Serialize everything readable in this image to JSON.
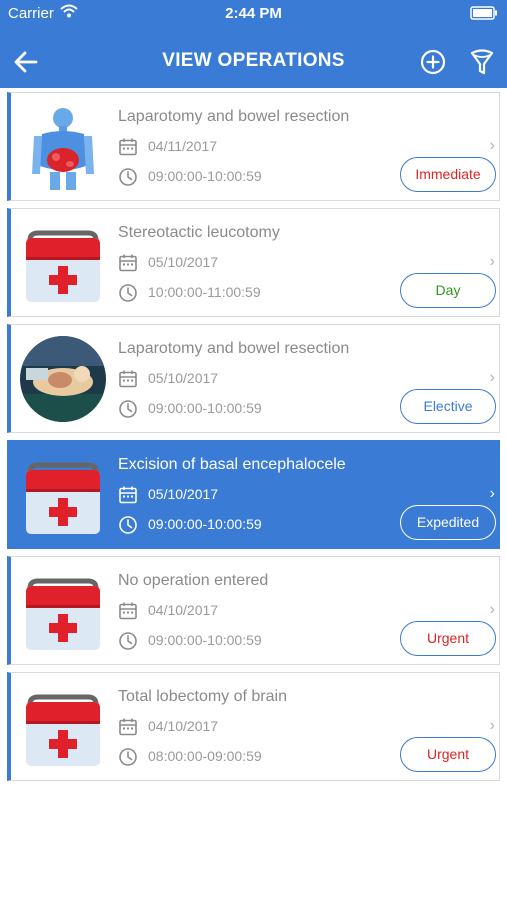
{
  "status_bar": {
    "carrier": "Carrier",
    "time": "2:44 PM"
  },
  "header": {
    "title": "VIEW OPERATIONS"
  },
  "operations": [
    {
      "title": "Laparotomy and bowel resection",
      "date": "04/11/2017",
      "time": "09:00:00-10:00:59",
      "badge": "Immediate",
      "badge_color": "#e02424",
      "image": "body-xray-image"
    },
    {
      "title": "Stereotactic leucotomy",
      "date": "05/10/2017",
      "time": "10:00:00-11:00:59",
      "badge": "Day",
      "badge_color": "#2e9a1f",
      "image": "medical-kit-image"
    },
    {
      "title": "Laparotomy and bowel resection",
      "date": "05/10/2017",
      "time": "09:00:00-10:00:59",
      "badge": "Elective",
      "badge_color": "#3a7bd5",
      "image": "surgery-photo"
    },
    {
      "title": "Excision of basal encephalocele",
      "date": "05/10/2017",
      "time": "09:00:00-10:00:59",
      "badge": "Expedited",
      "badge_color": "#ffffff",
      "image": "medical-kit-image"
    },
    {
      "title": "No operation entered",
      "date": "04/10/2017",
      "time": "09:00:00-10:00:59",
      "badge": "Urgent",
      "badge_color": "#e02424",
      "image": "medical-kit-image"
    },
    {
      "title": "Total lobectomy of brain",
      "date": "04/10/2017",
      "time": "08:00:00-09:00:59",
      "badge": "Urgent",
      "badge_color": "#e02424",
      "image": "medical-kit-image"
    }
  ],
  "colors": {
    "accent": "#3a7bd5"
  }
}
